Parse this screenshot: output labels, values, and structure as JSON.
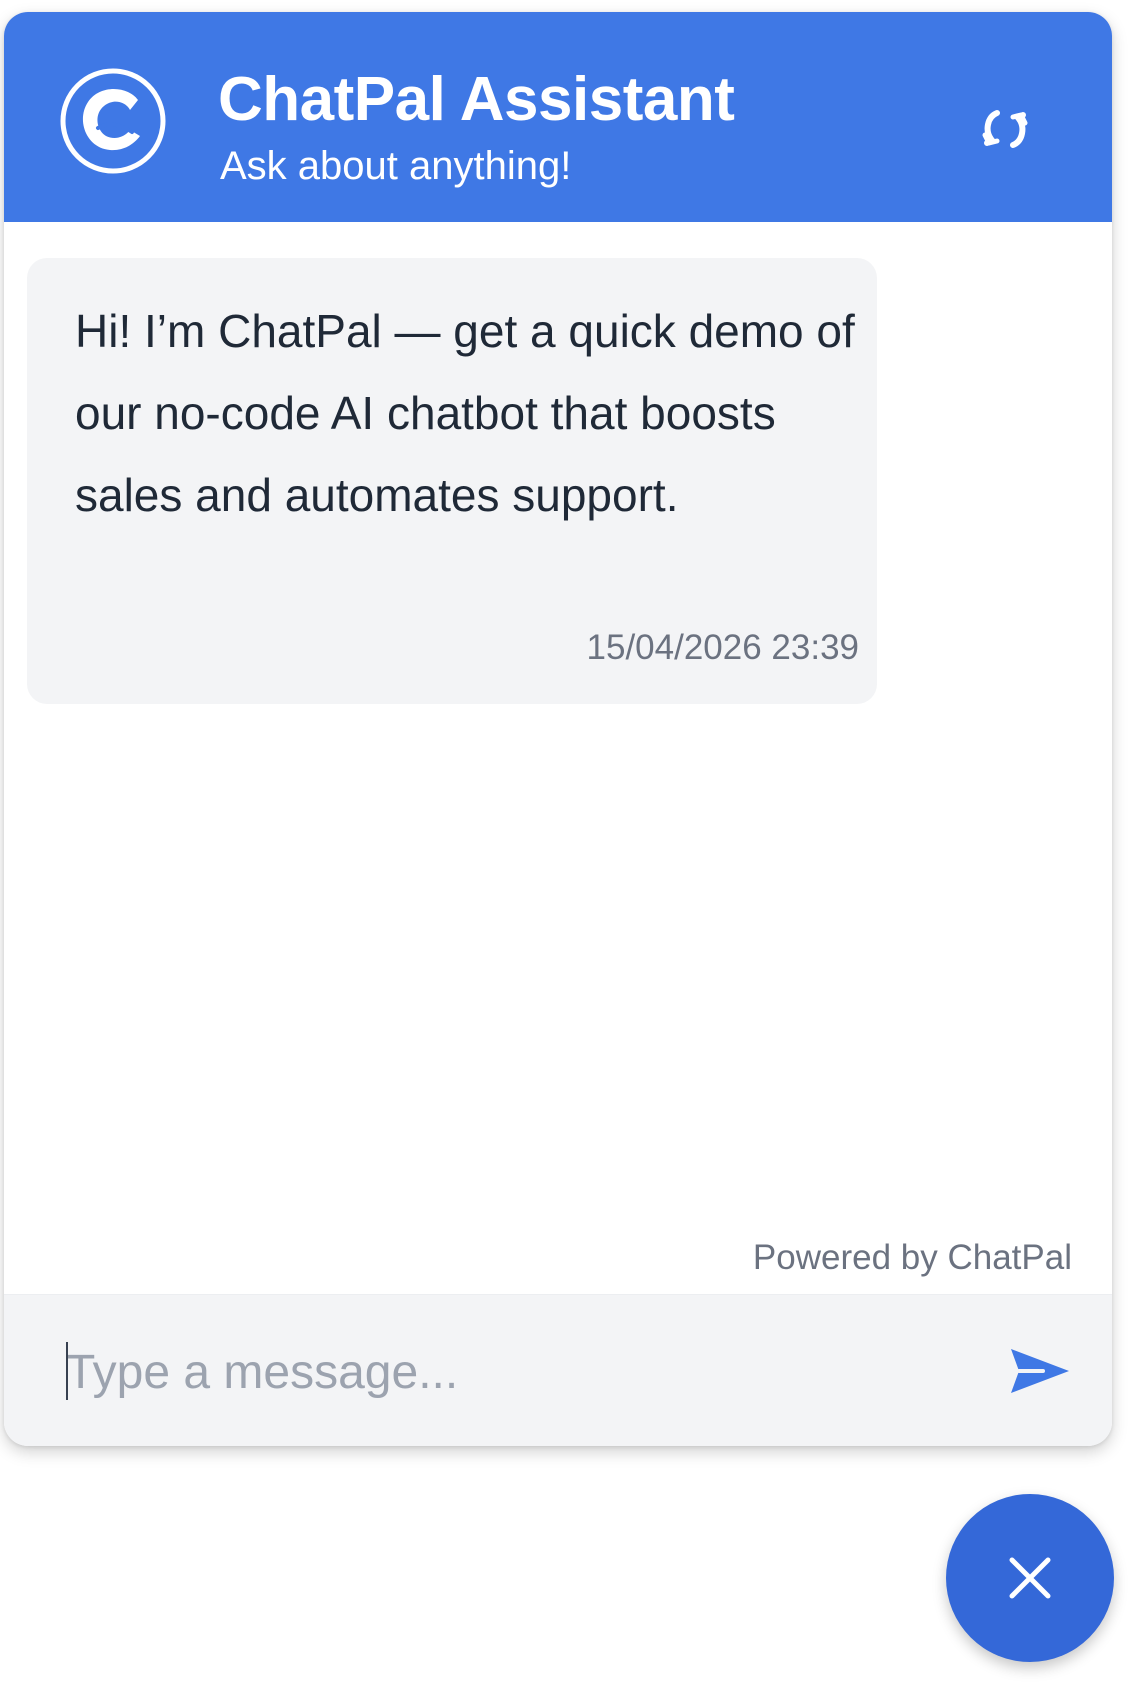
{
  "header": {
    "title": "ChatPal Assistant",
    "subtitle": "Ask about anything!",
    "logo_icon": "chatpal-logo",
    "refresh_icon": "refresh-icon"
  },
  "messages": [
    {
      "sender": "bot",
      "text": "Hi! I’m ChatPal — get a quick demo of our no-code AI chatbot that boosts sales and automates support.",
      "timestamp": "15/04/2026 23:39"
    }
  ],
  "footer": {
    "powered_by": "Powered by ChatPal"
  },
  "composer": {
    "placeholder": "Type a message...",
    "value": "",
    "send_icon": "send-icon"
  },
  "launcher": {
    "close_icon": "close-icon"
  },
  "colors": {
    "brand": "#3f78e5",
    "launcher": "#3468d8",
    "bubble_bg": "#f3f4f6",
    "text_primary": "#1f2937",
    "text_muted": "#6b7280"
  }
}
